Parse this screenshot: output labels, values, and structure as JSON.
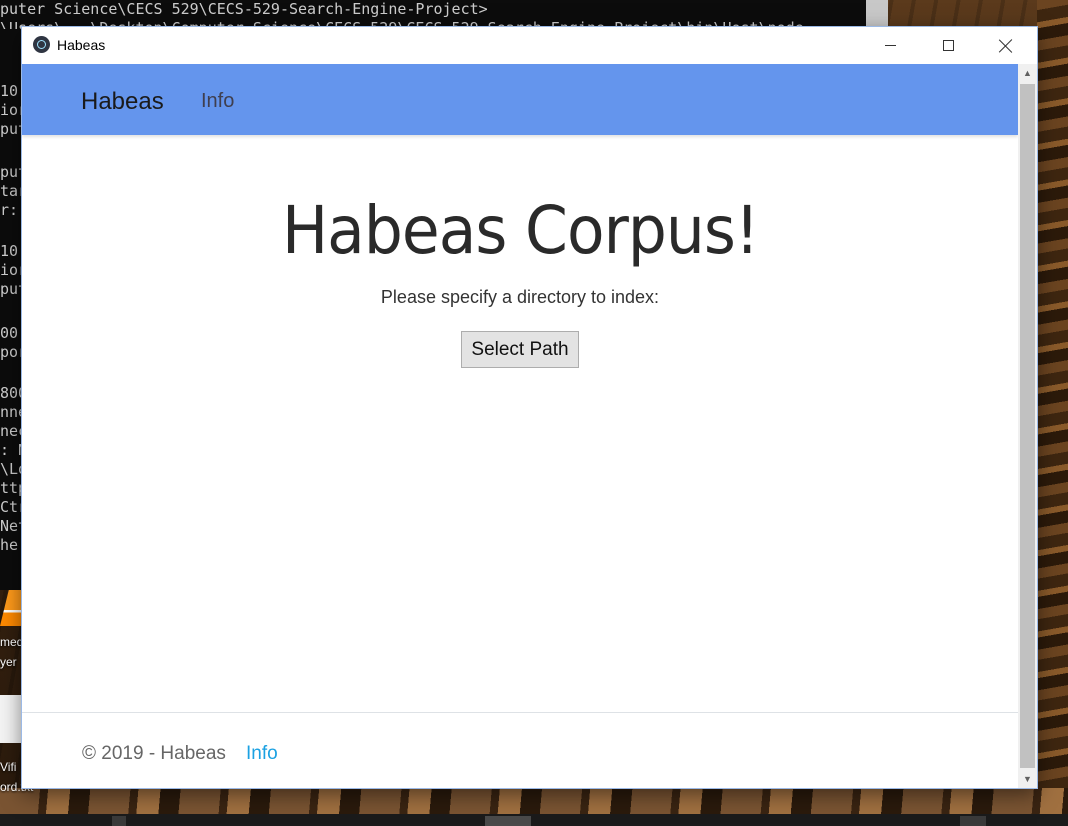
{
  "console": {
    "lines": [
      "puter Science\\CECS 529\\CECS-529-Search-Engine-Project>",
      "\\Users\\...\\Desktop\\Computer Science\\CECS 529\\CECS-529-Search-Engine-Project\\bin\\Host\\node",
      "",
      "",
      "10",
      "ior",
      "put",
      "",
      "put",
      "tar",
      "r:",
      "",
      "10",
      "ior",
      "put",
      "",
      "00",
      "por",
      "",
      "800",
      "nne",
      "nec",
      ": N",
      "\\Lo",
      "ttp",
      "Ctr",
      "Net",
      "he"
    ]
  },
  "desktop": {
    "icon1_label_1": "med",
    "icon1_label_2": "yer",
    "icon2_label_1": "Vifi",
    "icon2_label_2": "ord.txt"
  },
  "window": {
    "title": "Habeas"
  },
  "navbar": {
    "brand": "Habeas",
    "link": "Info"
  },
  "main": {
    "heading": "Habeas Corpus!",
    "prompt": "Please specify a directory to index:",
    "button": "Select Path"
  },
  "footer": {
    "copyright": "© 2019 - Habeas",
    "link": "Info"
  },
  "colors": {
    "navbar": "#6495ed",
    "footer_link": "#1ba1e2",
    "console_bg": "#0c0c0c"
  }
}
